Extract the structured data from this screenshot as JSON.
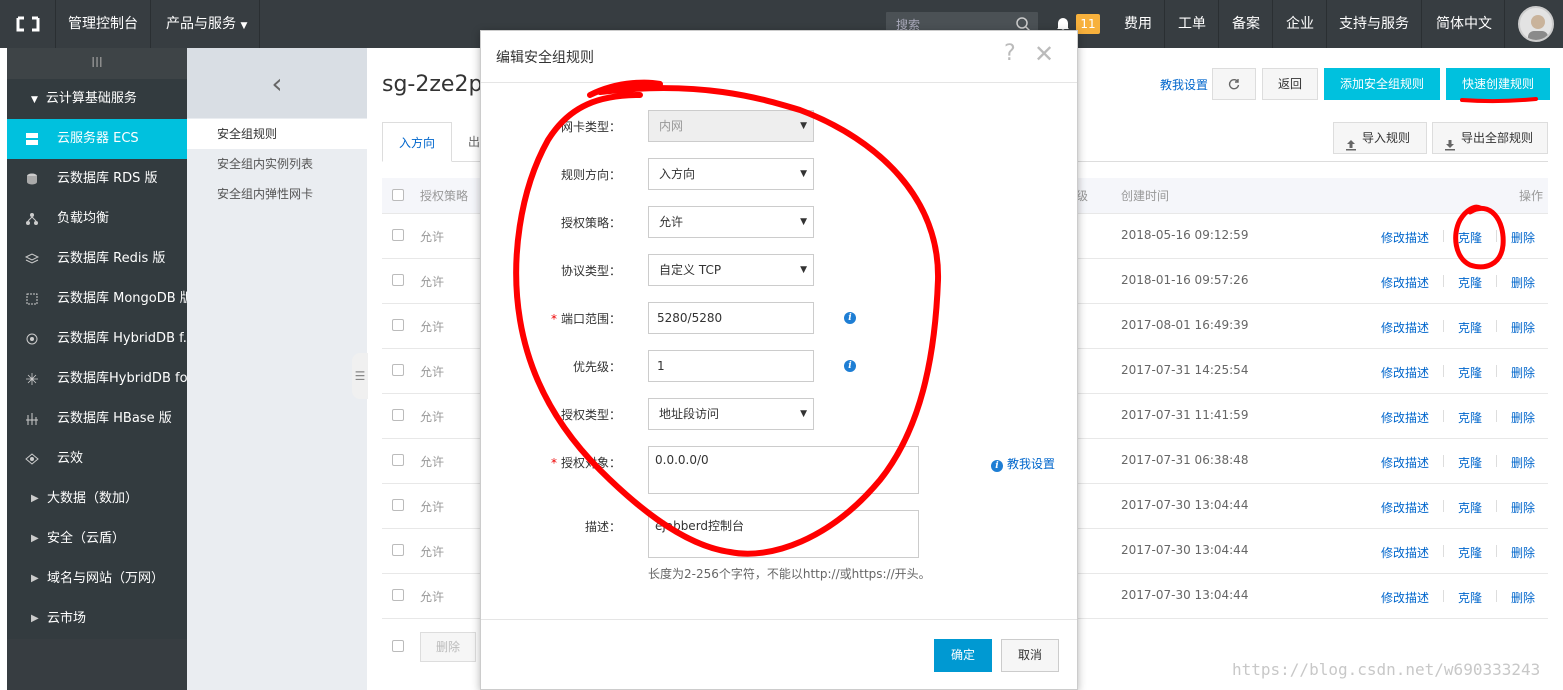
{
  "topbar": {
    "console": "管理控制台",
    "products": "产品与服务",
    "search_placeholder": "搜索",
    "badge_count": "11",
    "items": [
      "费用",
      "工单",
      "备案",
      "企业",
      "支持与服务",
      "简体中文"
    ]
  },
  "sidebar": {
    "collapse": "III",
    "group": "云计算基础服务",
    "items": [
      {
        "label": "云服务器 ECS",
        "icon": "server-icon"
      },
      {
        "label": "云数据库 RDS 版",
        "icon": "database-icon"
      },
      {
        "label": "负载均衡",
        "icon": "load-balancer-icon"
      },
      {
        "label": "云数据库 Redis 版",
        "icon": "redis-icon"
      },
      {
        "label": "云数据库 MongoDB 版",
        "icon": "mongodb-icon"
      },
      {
        "label": "云数据库 HybridDB f...",
        "icon": "hybriddb-icon"
      },
      {
        "label": "云数据库HybridDB fo...",
        "icon": "hybriddb2-icon"
      },
      {
        "label": "云数据库 HBase 版",
        "icon": "hbase-icon"
      },
      {
        "label": "云效",
        "icon": "yunxiao-icon"
      }
    ],
    "subs": [
      "大数据（数加）",
      "安全（云盾）",
      "域名与网站（万网）",
      "云市场"
    ]
  },
  "subnav": {
    "items": [
      "安全组规则",
      "安全组内实例列表",
      "安全组内弹性网卡"
    ]
  },
  "main": {
    "title": "sg-2ze2p",
    "teach_link": "教我设置",
    "back": "返回",
    "add_rule": "添加安全组规则",
    "quick_create": "快速创建规则",
    "tab_in": "入方向",
    "tab_out": "出",
    "import": "导入规则",
    "export": "导出全部规则",
    "col_policy": "授权策略",
    "col_level": "级",
    "col_created": "创建时间",
    "col_actions": "操作",
    "rows": [
      {
        "policy": "允许",
        "time": "2018-05-16 09:12:59"
      },
      {
        "policy": "允许",
        "time": "2018-01-16 09:57:26"
      },
      {
        "policy": "允许",
        "time": "2017-08-01 16:49:39"
      },
      {
        "policy": "允许",
        "time": "2017-07-31 14:25:54"
      },
      {
        "policy": "允许",
        "time": "2017-07-31 11:41:59"
      },
      {
        "policy": "允许",
        "time": "2017-07-31 06:38:48"
      },
      {
        "policy": "允许",
        "time": "2017-07-30 13:04:44"
      },
      {
        "policy": "允许",
        "time": "2017-07-30 13:04:44"
      },
      {
        "policy": "允许",
        "time": "2017-07-30 13:04:44"
      }
    ],
    "action_edit": "修改描述",
    "action_clone": "克隆",
    "action_delete": "删除",
    "delete_button": "删除"
  },
  "modal": {
    "title": "编辑安全组规则",
    "nic_label": "网卡类型：",
    "nic_value": "内网",
    "direction_label": "规则方向：",
    "direction_value": "入方向",
    "policy_label": "授权策略：",
    "policy_value": "允许",
    "protocol_label": "协议类型：",
    "protocol_value": "自定义 TCP",
    "port_label": "端口范围：",
    "port_value": "5280/5280",
    "priority_label": "优先级：",
    "priority_value": "1",
    "auth_type_label": "授权类型：",
    "auth_type_value": "地址段访问",
    "auth_obj_label": "授权对象：",
    "auth_obj_value": "0.0.0.0/0",
    "teach": "教我设置",
    "desc_label": "描述：",
    "desc_value": "ejabberd控制台",
    "hint": "长度为2-256个字符，不能以http://或https://开头。",
    "ok": "确定",
    "cancel": "取消"
  },
  "watermark": "https://blog.csdn.net/w690333243",
  "colors": {
    "accent": "#00c1de",
    "topbar": "#373d41",
    "sidebar": "#333b3f",
    "link": "#0066cc",
    "annotation": "#ff0000"
  }
}
